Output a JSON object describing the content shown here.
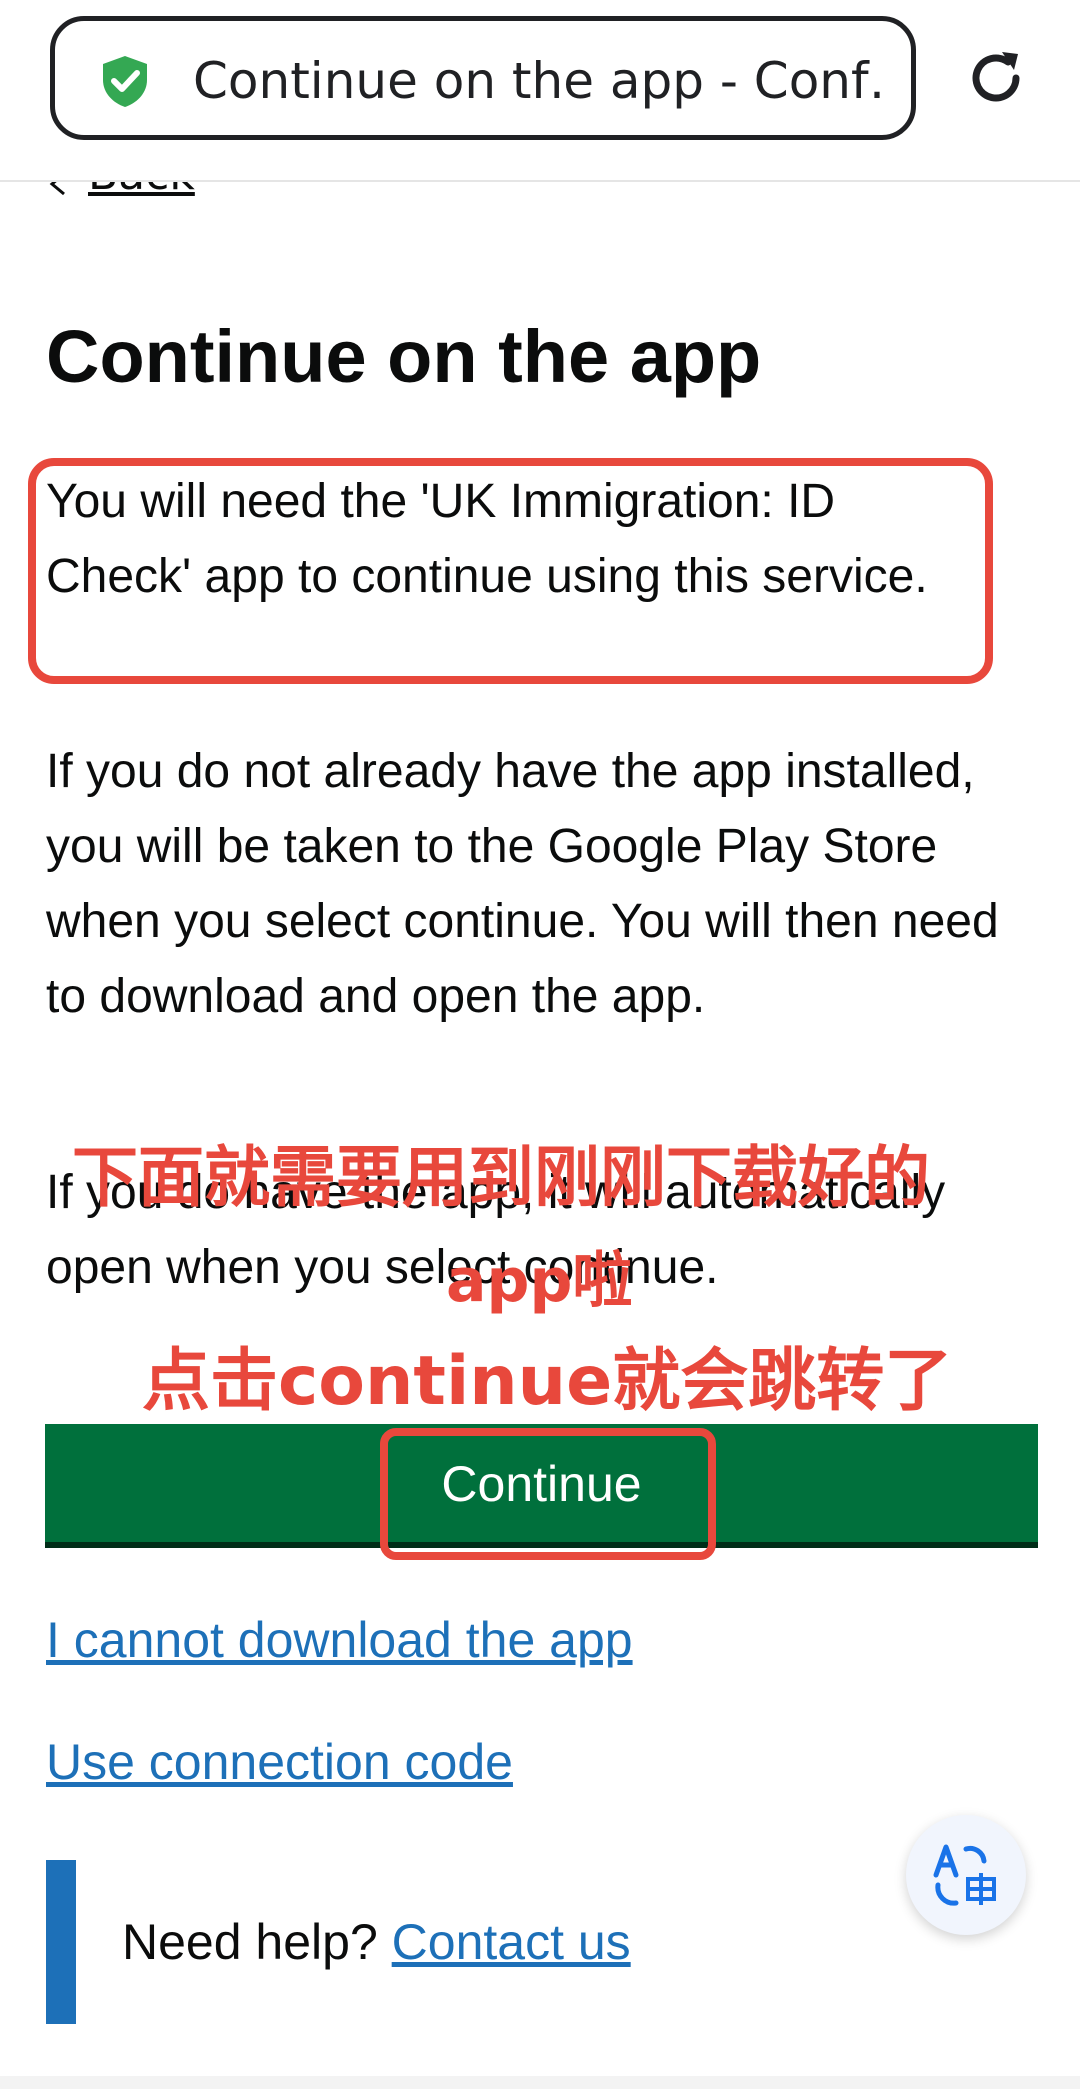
{
  "browser": {
    "url_title": "Continue on the app - Conf…",
    "security_icon": "shield-check-icon",
    "reload_icon": "reload-icon",
    "accent_color": "#34a853"
  },
  "page": {
    "back_label": "Back",
    "title": "Continue on the app",
    "paragraphs": [
      "You will need the 'UK Immigration: ID Check' app to continue using this service.",
      "If you do not already have the app installed, you will be taken to the Google Play Store when you select continue. You will then need to download and open the app.",
      "If you do have the app, it will automatically open when you select continue."
    ],
    "continue_label": "Continue",
    "links": [
      "I cannot download the app",
      "Use connection code"
    ],
    "help_prefix": "Need help?",
    "help_link": "Contact us",
    "button_color": "#00703c",
    "link_color": "#1d70b8"
  },
  "annotation": {
    "line1": "下面就需要用到刚刚下载好的",
    "line2": "app啦",
    "line3": "点击continue就会跳转了",
    "color": "#e8483c"
  },
  "translate": {
    "icon": "translate-icon"
  }
}
